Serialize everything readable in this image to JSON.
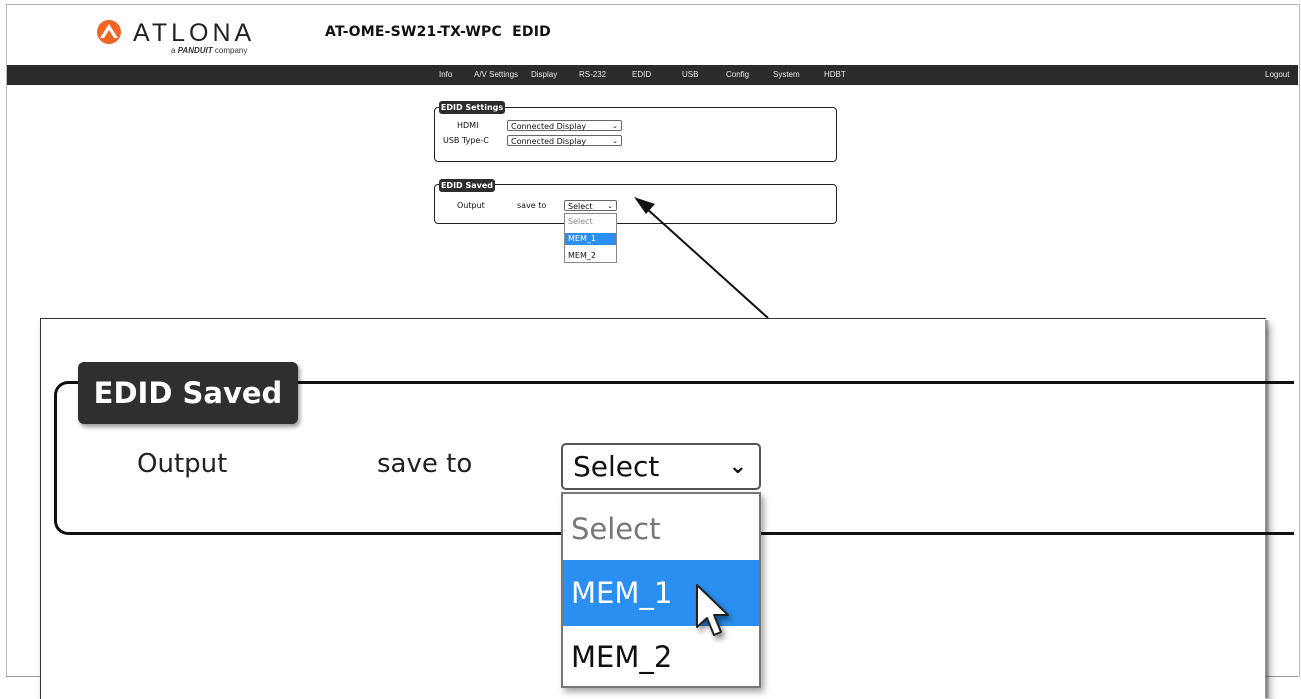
{
  "header": {
    "brand": "ATLONA",
    "brand_sub_prefix": "a",
    "brand_sub_bold": "PANDUIT",
    "brand_sub_suffix": "company",
    "title": "AT-OME-SW21-TX-WPC  EDID"
  },
  "nav": {
    "items": [
      "Info",
      "A/V Settings",
      "Display",
      "RS-232",
      "EDID",
      "USB",
      "Config",
      "System",
      "HDBT"
    ],
    "logout": "Logout"
  },
  "edid_settings": {
    "legend": "EDID Settings",
    "rows": [
      {
        "label": "HDMI",
        "value": "Connected Display"
      },
      {
        "label": "USB Type-C",
        "value": "Connected Display"
      }
    ]
  },
  "edid_saved": {
    "legend": "EDID Saved",
    "output_label": "Output",
    "save_to_label": "save to",
    "select_value": "Select",
    "options": [
      "Select",
      "MEM_1",
      "MEM_2"
    ],
    "highlighted_option": "MEM_1"
  },
  "colors": {
    "navbar": "#2b2b2b",
    "legend_bg": "#2d2d2d",
    "highlight": "#2a8ff0",
    "brand_orange": "#f26522"
  },
  "icons": [
    "atlona-logo-icon",
    "chevron-down-icon",
    "pointer-cursor-icon",
    "callout-arrow-icon"
  ]
}
